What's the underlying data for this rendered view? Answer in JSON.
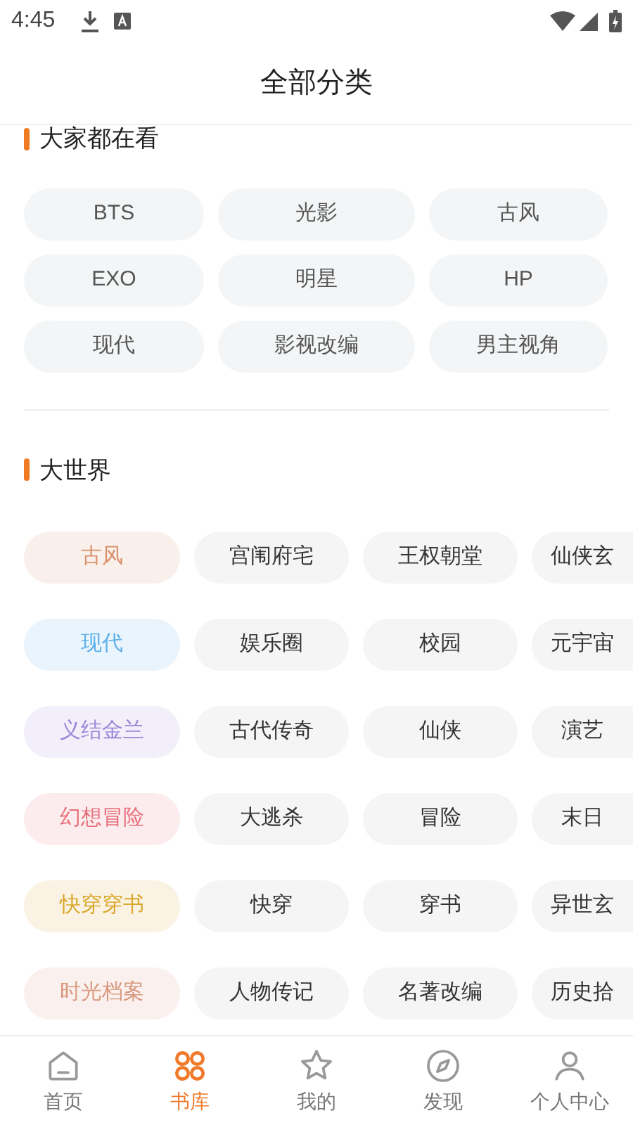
{
  "status_bar": {
    "time": "4:45"
  },
  "header": {
    "title": "全部分类"
  },
  "popular": {
    "title": "大家都在看",
    "tags": [
      "BTS",
      "光影",
      "古风",
      "EXO",
      "明星",
      "HP",
      "现代",
      "影视改编",
      "男主视角"
    ]
  },
  "world": {
    "title": "大世界",
    "groups": [
      {
        "label": "古风",
        "color": "#d98f6a",
        "tags": [
          "宫闱府宅",
          "王权朝堂",
          "仙侠玄"
        ]
      },
      {
        "label": "现代",
        "color": "#5cb0ea",
        "tags": [
          "娱乐圈",
          "校园",
          "元宇宙"
        ]
      },
      {
        "label": "义结金兰",
        "color": "#9a88d8",
        "tags": [
          "古代传奇",
          "仙侠",
          "演艺"
        ]
      },
      {
        "label": "幻想冒险",
        "color": "#e66f7a",
        "tags": [
          "大逃杀",
          "冒险",
          "末日"
        ]
      },
      {
        "label": "快穿穿书",
        "color": "#d9a72c",
        "tags": [
          "快穿",
          "穿书",
          "异世玄"
        ]
      },
      {
        "label": "时光档案",
        "color": "#d9987e",
        "tags": [
          "人物传记",
          "名著改编",
          "历史拾"
        ]
      }
    ]
  },
  "nav": [
    {
      "label": "首页",
      "kind": "home",
      "selected": false
    },
    {
      "label": "书库",
      "kind": "library",
      "selected": true
    },
    {
      "label": "我的",
      "kind": "star",
      "selected": false
    },
    {
      "label": "发现",
      "kind": "compass",
      "selected": false
    },
    {
      "label": "个人中心",
      "kind": "person",
      "selected": false
    }
  ]
}
